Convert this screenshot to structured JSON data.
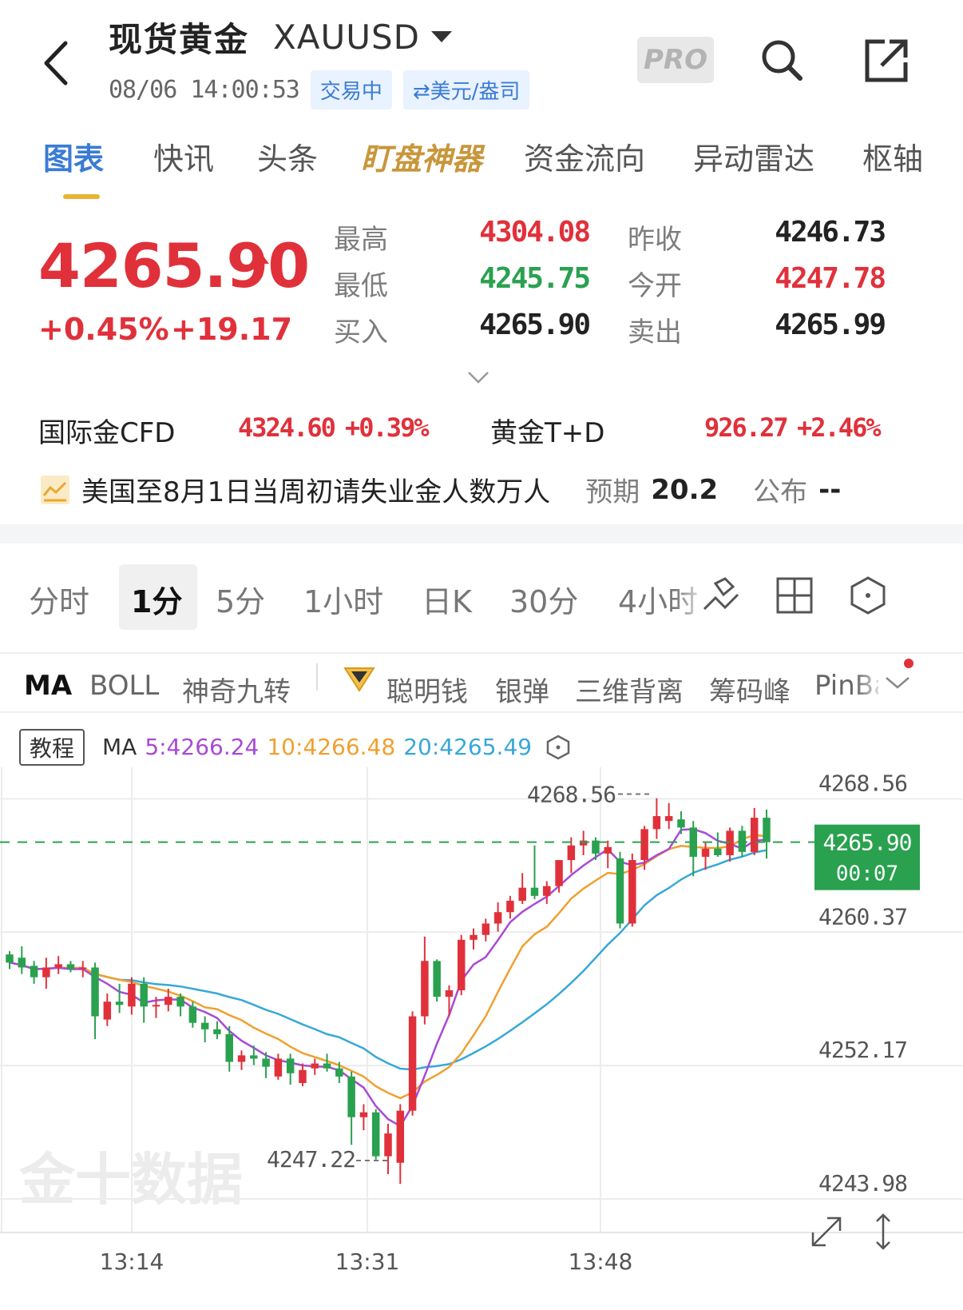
{
  "header": {
    "title": "现货黄金",
    "symbol": "XAUUSD",
    "datetime": "08/06 14:00:53",
    "status_chip": "交易中",
    "unit_chip": "⇄美元/盎司",
    "pro_label": "PRO"
  },
  "tabs": [
    "图表",
    "快讯",
    "头条",
    "盯盘神器",
    "资金流向",
    "异动雷达",
    "枢轴"
  ],
  "quote": {
    "price": "4265.90",
    "change_pct": "+0.45%",
    "change_abs": "+19.17",
    "high_label": "最高",
    "high": "4304.08",
    "low_label": "最低",
    "low": "4245.75",
    "bid_label": "买入",
    "bid": "4265.90",
    "prev_close_label": "昨收",
    "prev_close": "4246.73",
    "open_label": "今开",
    "open": "4247.78",
    "ask_label": "卖出",
    "ask": "4265.99"
  },
  "related": {
    "cfd_label": "国际金CFD",
    "cfd_price": "4324.60",
    "cfd_change": "+0.39%",
    "td_label": "黄金T+D",
    "td_price": "926.27",
    "td_change": "+2.46%"
  },
  "event": {
    "text": "美国至8月1日当周初请失业金人数万人",
    "forecast_label": "预期",
    "forecast": "20.2",
    "actual_label": "公布",
    "actual": "--"
  },
  "periods": [
    "分时",
    "1分",
    "5分",
    "1小时",
    "日K",
    "30分",
    "4小时"
  ],
  "indicators": [
    "MA",
    "BOLL",
    "神奇九转",
    "聪明钱",
    "银弹",
    "三维背离",
    "筹码峰",
    "PinBar"
  ],
  "tutorial_label": "教程",
  "ma_legend": {
    "label": "MA",
    "ma5": "5:4266.24",
    "ma10": "10:4266.48",
    "ma20": "20:4265.49"
  },
  "colors": {
    "up": "#e0313b",
    "down": "#2aa14f",
    "ma5": "#a84ad6",
    "ma10": "#f0a030",
    "ma20": "#38a8d8",
    "accent": "#3a7bd5"
  },
  "chart_data": {
    "type": "candlestick",
    "y_ticks": [
      "4268.56",
      "4260.37",
      "4252.17",
      "4243.98"
    ],
    "x_ticks": [
      "13:14",
      "13:31",
      "13:48"
    ],
    "ylim": [
      4243.98,
      4270.5
    ],
    "current_price": "4265.90",
    "countdown": "00:07",
    "high_marker": "4268.56",
    "low_marker": "4247.22",
    "watermark": "金十数据",
    "candles": [
      [
        4259.0,
        4259.2,
        4258.1,
        4258.5
      ],
      [
        4258.8,
        4259.5,
        4257.8,
        4258.2
      ],
      [
        4258.3,
        4258.6,
        4257.2,
        4257.6
      ],
      [
        4257.6,
        4258.8,
        4256.9,
        4258.2
      ],
      [
        4258.2,
        4258.9,
        4257.8,
        4258.4
      ],
      [
        4258.4,
        4258.6,
        4257.9,
        4258.1
      ],
      [
        4258.1,
        4258.6,
        4257.6,
        4258.2
      ],
      [
        4258.2,
        4258.5,
        4253.8,
        4255.2
      ],
      [
        4255.0,
        4256.6,
        4254.6,
        4256.1
      ],
      [
        4256.1,
        4257.2,
        4255.4,
        4255.9
      ],
      [
        4255.8,
        4257.6,
        4255.3,
        4257.2
      ],
      [
        4257.2,
        4257.6,
        4254.8,
        4255.8
      ],
      [
        4255.8,
        4256.4,
        4255.1,
        4255.9
      ],
      [
        4255.9,
        4256.9,
        4255.5,
        4256.4
      ],
      [
        4256.4,
        4256.6,
        4255.2,
        4255.8
      ],
      [
        4255.8,
        4256.1,
        4254.5,
        4254.8
      ],
      [
        4254.8,
        4255.2,
        4253.6,
        4254.4
      ],
      [
        4254.4,
        4254.9,
        4253.8,
        4254.1
      ],
      [
        4254.1,
        4254.6,
        4251.8,
        4252.4
      ],
      [
        4252.4,
        4253.1,
        4251.9,
        4252.8
      ],
      [
        4252.8,
        4253.4,
        4252.2,
        4252.6
      ],
      [
        4252.6,
        4253.0,
        4251.4,
        4252.1
      ],
      [
        4251.5,
        4252.9,
        4251.3,
        4252.6
      ],
      [
        4252.6,
        4252.9,
        4251.0,
        4251.7
      ],
      [
        4251.1,
        4252.3,
        4250.9,
        4251.9
      ],
      [
        4252.0,
        4252.6,
        4251.6,
        4252.3
      ],
      [
        4252.3,
        4252.9,
        4251.8,
        4252.0
      ],
      [
        4252.0,
        4252.4,
        4251.1,
        4251.5
      ],
      [
        4251.5,
        4251.8,
        4247.3,
        4249.0
      ],
      [
        4249.0,
        4249.8,
        4248.2,
        4249.3
      ],
      [
        4249.3,
        4249.5,
        4246.4,
        4246.6
      ],
      [
        4246.6,
        4248.6,
        4245.5,
        4248.0
      ],
      [
        4246.2,
        4249.8,
        4244.9,
        4249.4
      ],
      [
        4249.4,
        4255.5,
        4249.1,
        4255.2
      ],
      [
        4255.2,
        4260.1,
        4254.7,
        4258.6
      ],
      [
        4258.6,
        4258.7,
        4256.1,
        4256.4
      ],
      [
        4256.4,
        4257.1,
        4255.2,
        4256.8
      ],
      [
        4256.8,
        4260.2,
        4256.5,
        4259.9
      ],
      [
        4259.9,
        4260.6,
        4259.3,
        4260.2
      ],
      [
        4260.2,
        4261.2,
        4259.8,
        4260.9
      ],
      [
        4260.9,
        4262.2,
        4260.4,
        4261.6
      ],
      [
        4261.6,
        4262.6,
        4261.2,
        4262.3
      ],
      [
        4262.3,
        4264.0,
        4262.1,
        4263.1
      ],
      [
        4263.1,
        4265.7,
        4262.4,
        4262.6
      ],
      [
        4262.6,
        4263.5,
        4262.1,
        4263.2
      ],
      [
        4263.2,
        4264.0,
        4262.8,
        4264.8
      ],
      [
        4264.8,
        4266.2,
        4264.0,
        4265.7
      ],
      [
        4265.7,
        4266.6,
        4265.1,
        4266.0
      ],
      [
        4266.0,
        4266.2,
        4264.8,
        4265.2
      ],
      [
        4265.2,
        4266.0,
        4264.3,
        4265.6
      ],
      [
        4264.9,
        4265.3,
        4260.6,
        4260.9
      ],
      [
        4260.9,
        4265.2,
        4260.7,
        4264.8
      ],
      [
        4264.8,
        4266.9,
        4264.2,
        4266.7
      ],
      [
        4266.7,
        4268.6,
        4266.1,
        4267.5
      ],
      [
        4267.2,
        4268.3,
        4266.7,
        4267.5
      ],
      [
        4267.3,
        4267.8,
        4266.4,
        4266.8
      ],
      [
        4266.8,
        4267.2,
        4263.8,
        4265.0
      ],
      [
        4265.0,
        4265.9,
        4264.2,
        4265.5
      ],
      [
        4265.5,
        4266.5,
        4265.0,
        4265.1
      ],
      [
        4265.1,
        4266.8,
        4264.7,
        4266.6
      ],
      [
        4266.6,
        4266.9,
        4265.0,
        4265.3
      ],
      [
        4265.3,
        4268.0,
        4265.1,
        4267.4
      ],
      [
        4267.4,
        4267.9,
        4264.9,
        4265.9
      ]
    ]
  }
}
